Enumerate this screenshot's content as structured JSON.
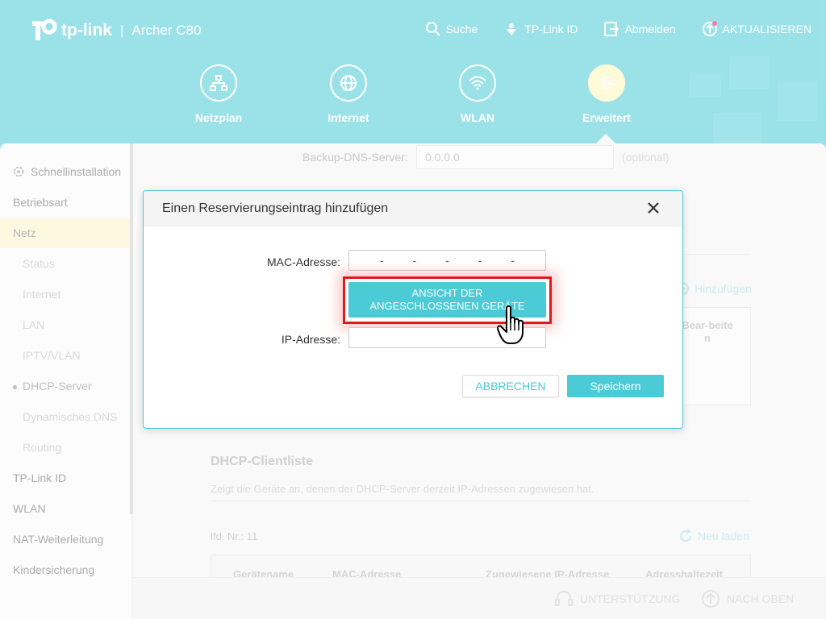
{
  "header": {
    "brand": "tp-link",
    "separator": "|",
    "model": "Archer C80",
    "topnav": [
      {
        "label": "Suche",
        "icon": "search-icon"
      },
      {
        "label": "TP-Link ID",
        "icon": "tplink-id-icon"
      },
      {
        "label": "Abmelden",
        "icon": "logout-icon"
      },
      {
        "label": "AKTUALISIEREN",
        "icon": "update-icon"
      }
    ],
    "mainnav": [
      {
        "label": "Netzplan",
        "icon": "network-map-icon"
      },
      {
        "label": "Internet",
        "icon": "globe-icon"
      },
      {
        "label": "WLAN",
        "icon": "wifi-icon"
      },
      {
        "label": "Erweitert",
        "icon": "gear-icon",
        "active": true
      }
    ]
  },
  "sidebar": {
    "items": [
      {
        "label": "Schnellinstallation",
        "icon": "quick-setup-icon"
      },
      {
        "label": "Betriebsart"
      },
      {
        "label": "Netz"
      },
      {
        "label": "Status"
      },
      {
        "label": "Internet"
      },
      {
        "label": "LAN"
      },
      {
        "label": "IPTV/VLAN"
      },
      {
        "label": "DHCP-Server"
      },
      {
        "label": "Dynamisches DNS"
      },
      {
        "label": "Routing"
      },
      {
        "label": "TP-Link ID"
      },
      {
        "label": "WLAN"
      },
      {
        "label": "NAT-Weiterleitung"
      },
      {
        "label": "Kindersicherung"
      }
    ]
  },
  "content": {
    "backup_dns_label": "Backup-DNS-Server:",
    "backup_dns_value": "0.0.0.0",
    "backup_dns_optional": "(optional)",
    "add_link": "Hinzufügen",
    "table_col_edit": "Bear-beite n",
    "client_list_title": "DHCP-Clientliste",
    "client_list_desc": "Zeigt die Geräte an, denen der DHCP-Server derzeit IP-Adressen zugewiesen hat.",
    "count_label": "lfd. Nr.: 11",
    "reload_link": "Neu laden",
    "columns": [
      "Gerätename",
      "MAC-Adresse",
      "Zugewiesene IP-Adresse",
      "Adresshaltezeit"
    ]
  },
  "footer": {
    "support": "UNTERSTÜTZUNG",
    "back_to_top": "NACH OBEN"
  },
  "modal": {
    "title": "Einen Reservierungseintrag hinzufügen",
    "mac_label": "MAC-Adresse:",
    "mac_separators": [
      "-",
      "-",
      "-",
      "-",
      "-"
    ],
    "view_devices_line1": "ANSICHT DER",
    "view_devices_line2": "ANGESCHLOSSENEN GERÄTE",
    "ip_label": "IP-Adresse:",
    "ip_value": "",
    "cancel": "ABBRECHEN",
    "save": "Speichern"
  },
  "colors": {
    "accent": "#4acbd6",
    "highlight": "#e0191b",
    "active_nav": "#fff6b8"
  }
}
